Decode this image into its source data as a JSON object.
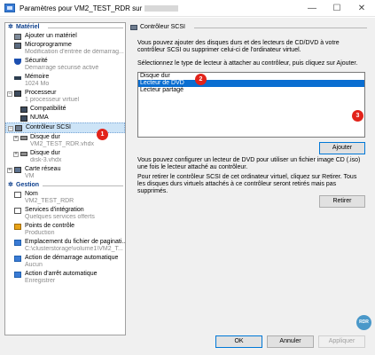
{
  "window": {
    "title": "Paramètres pour VM2_TEST_RDR sur",
    "minimize": "—",
    "maximize": "☐",
    "close": "✕"
  },
  "tree": {
    "materiel_header": "Matériel",
    "gestion_header": "Gestion",
    "items": {
      "ajouter": {
        "label": "Ajouter un matériel"
      },
      "microprog": {
        "label": "Microprogramme",
        "sub": "Modification d'entrée de démarrag..."
      },
      "securite": {
        "label": "Sécurité",
        "sub": "Démarrage sécurisé activé"
      },
      "memoire": {
        "label": "Mémoire",
        "sub": "1024 Mo"
      },
      "processeur": {
        "label": "Processeur",
        "sub": "1 processeur virtuel"
      },
      "compat": {
        "label": "Compatibilité"
      },
      "numa": {
        "label": "NUMA"
      },
      "scsi": {
        "label": "Contrôleur SCSI"
      },
      "disque1": {
        "label": "Disque dur",
        "sub": "VM2_TEST_RDR.vhdx"
      },
      "disque2": {
        "label": "Disque dur",
        "sub": "disk-3.vhdx"
      },
      "reseau": {
        "label": "Carte réseau",
        "sub": "VM"
      },
      "nom": {
        "label": "Nom",
        "sub": "VM2_TEST_RDR"
      },
      "integration": {
        "label": "Services d'intégration",
        "sub": "Quelques services offerts"
      },
      "points": {
        "label": "Points de contrôle",
        "sub": "Production"
      },
      "pagination": {
        "label": "Emplacement du fichier de paginati...",
        "sub": "C:\\clusterstorage\\volume1\\VM2_T..."
      },
      "demarrage": {
        "label": "Action de démarrage automatique",
        "sub": "Aucun"
      },
      "arret": {
        "label": "Action d'arrêt automatique",
        "sub": "Enregistrer"
      }
    }
  },
  "panel": {
    "header": "Contrôleur SCSI",
    "intro": "Vous pouvez ajouter des disques durs et des lecteurs de CD/DVD à votre contrôleur SCSI ou supprimer celui-ci de l'ordinateur virtuel.",
    "select_prompt": "Sélectionnez le type de lecteur à attacher au contrôleur, puis cliquez sur Ajouter.",
    "options": [
      "Disque dur",
      "Lecteur de DVD",
      "Lecteur partagé"
    ],
    "add_button": "Ajouter",
    "dvd_info": "Vous pouvez configurer un lecteur de DVD pour utiliser un fichier image CD (.iso) une fois le lecteur attaché au contrôleur.",
    "remove_info": "Pour retirer le contrôleur SCSI de cet ordinateur virtuel, cliquez sur Retirer. Tous les disques durs virtuels attachés à ce contrôleur seront retirés mais pas supprimés.",
    "remove_button": "Retirer"
  },
  "footer": {
    "ok": "OK",
    "cancel": "Annuler",
    "apply": "Appliquer"
  },
  "badges": {
    "one": "1",
    "two": "2",
    "three": "3"
  },
  "watermark": "RDR",
  "colors": {
    "accent": "#0a6ed1",
    "badge": "#e2231a",
    "header": "#0b3e8c"
  }
}
